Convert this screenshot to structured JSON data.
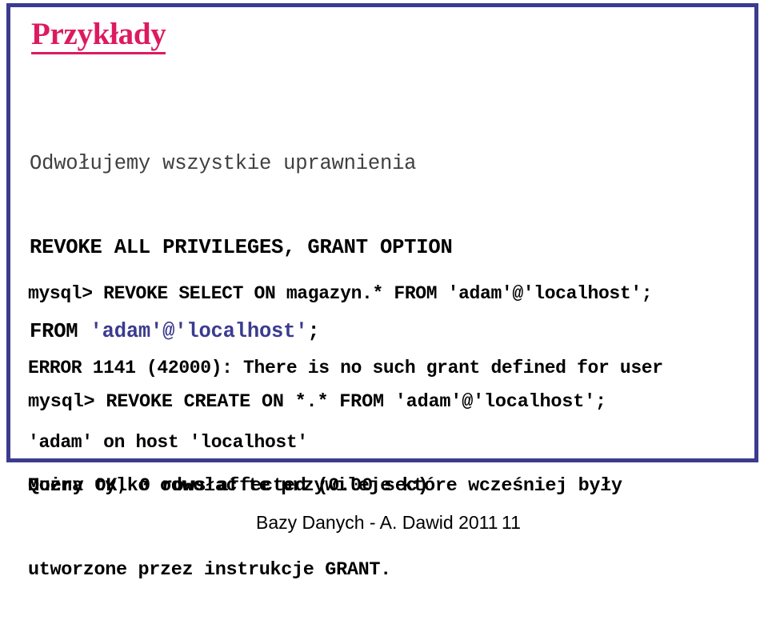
{
  "slide": {
    "title": "Przykłady",
    "frame_color": "#3b3b8f",
    "title_color": "#dd1a60",
    "accent_identifier_color": "#3b3b8f"
  },
  "content": {
    "revoke_all_block": {
      "note_line": "Odwołujemy wszystkie uprawnienia",
      "statement_line_1": "REVOKE ALL PRIVILEGES, GRANT OPTION",
      "statement_line_2_prefix": "FROM ",
      "statement_line_2_identifier": "'adam'@'localhost'",
      "statement_line_2_suffix": ";"
    },
    "revoke_select_block": {
      "prompt_line": "mysql> REVOKE SELECT ON magazyn.* FROM 'adam'@'localhost';",
      "error_line_1": "ERROR 1141 (42000): There is no such grant defined for user",
      "error_line_2": "'adam' on host 'localhost'"
    },
    "revoke_create_block": {
      "prompt_line": "mysql> REVOKE CREATE ON *.* FROM 'adam'@'localhost';",
      "result_line": "Query OK, 0 rows affected (0.00 sec)"
    },
    "closing_note": {
      "line_1": "Można tylko odwołać te przywileje które wcześniej były",
      "line_2": "utworzone przez instrukcje GRANT."
    }
  },
  "footer": {
    "credit": "Bazy Danych - A. Dawid 2011",
    "page_number": "11"
  }
}
